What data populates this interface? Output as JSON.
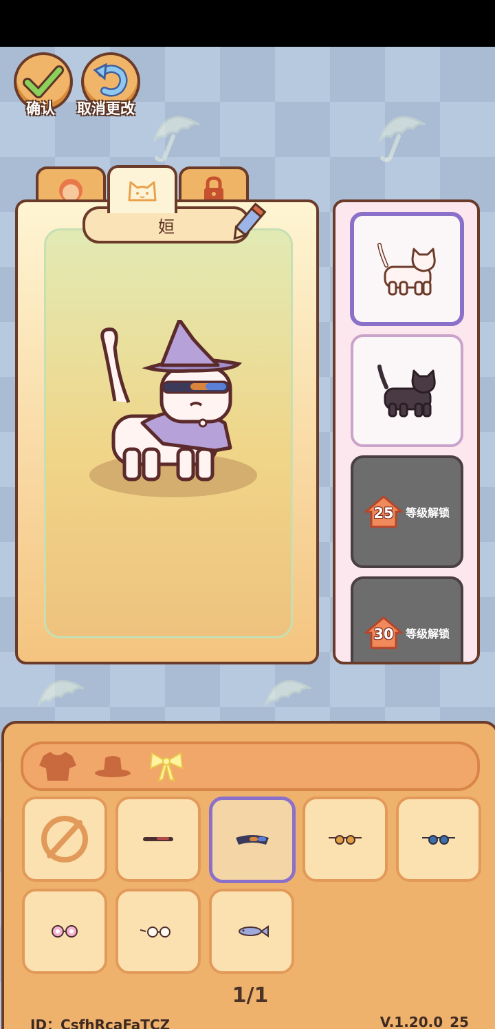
{
  "top_actions": {
    "confirm_label": "确认",
    "cancel_label": "取消更改"
  },
  "tabs": [
    {
      "icon": "avatar-icon",
      "state": "inactive"
    },
    {
      "icon": "cat-face-icon",
      "state": "active"
    },
    {
      "icon": "padlock-icon",
      "state": "locked"
    }
  ],
  "character": {
    "name": "姮",
    "edit_icon": "pencil-icon"
  },
  "skins": [
    {
      "id": "white-cat",
      "state": "selected"
    },
    {
      "id": "black-cat",
      "state": "available"
    },
    {
      "level": "25",
      "unlock_text": "等级解锁",
      "state": "locked"
    },
    {
      "level": "30",
      "unlock_text": "等级解锁",
      "state": "locked"
    }
  ],
  "category_tabs": [
    {
      "icon": "clothes-icon"
    },
    {
      "icon": "hat-icon"
    },
    {
      "icon": "bow-icon",
      "active": true
    }
  ],
  "accessories": [
    {
      "item": "none",
      "icon": "no-item-icon"
    },
    {
      "item": "dark-shades",
      "icon": "dark-glasses-icon"
    },
    {
      "item": "rainbow-visor",
      "icon": "visor-icon",
      "selected": true
    },
    {
      "item": "orange-round-glasses",
      "icon": "round-glasses-icon"
    },
    {
      "item": "blue-round-glasses",
      "icon": "round-glasses-icon"
    },
    {
      "item": "flower-glasses",
      "icon": "flower-glasses-icon"
    },
    {
      "item": "wire-glasses",
      "icon": "wire-glasses-icon"
    },
    {
      "item": "fish-glasses",
      "icon": "fish-icon"
    }
  ],
  "pagination": {
    "text": "1/1"
  },
  "footer": {
    "id_text": "ID：CsfhRcaFaTCZ",
    "version": "V.1.20.0_25"
  },
  "colors": {
    "accent": "#8a70c9",
    "border": "#6b3b2a",
    "panel": "#efb26d"
  }
}
